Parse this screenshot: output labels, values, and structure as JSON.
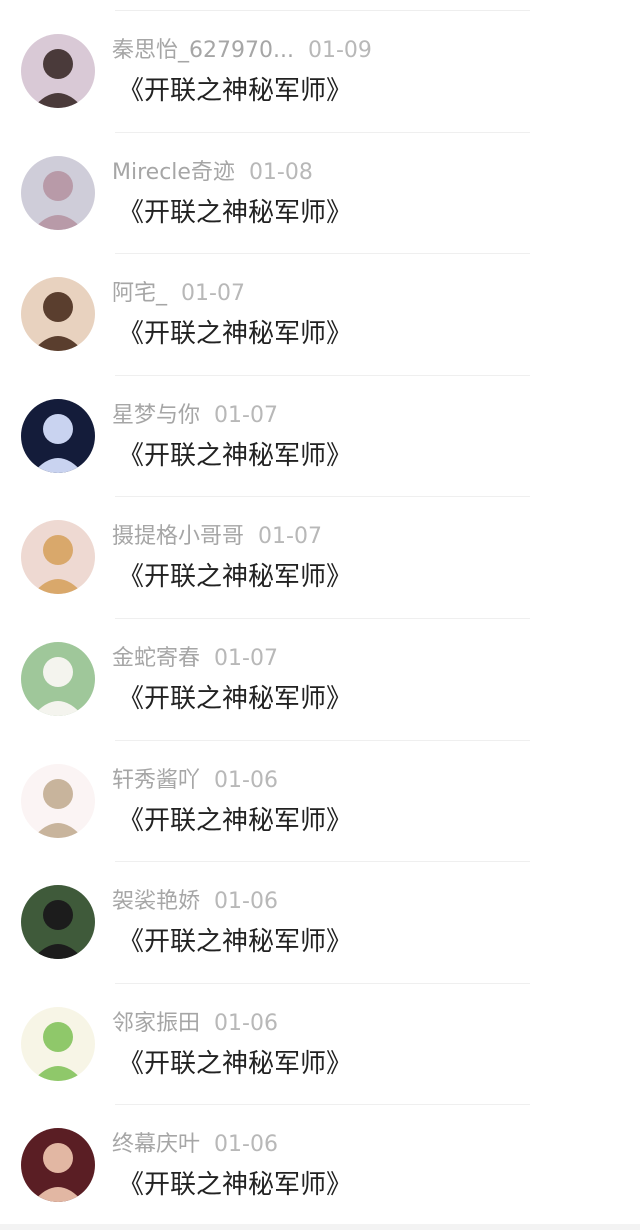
{
  "entries": [
    {
      "username": "秦思怡_627970...",
      "date": "01-09",
      "title": "《开联之神秘军师》",
      "avatar_bg": "#d9c9d6",
      "avatar_fg": "#4a3a3a"
    },
    {
      "username": "Mirecle奇迹",
      "date": "01-08",
      "title": "《开联之神秘军师》",
      "avatar_bg": "#cfcdd9",
      "avatar_fg": "#b89aa8"
    },
    {
      "username": "阿宅_",
      "date": "01-07",
      "title": "《开联之神秘军师》",
      "avatar_bg": "#e8d2bf",
      "avatar_fg": "#5a3e2e"
    },
    {
      "username": "星梦与你",
      "date": "01-07",
      "title": "《开联之神秘军师》",
      "avatar_bg": "#141c3a",
      "avatar_fg": "#c9d3f0"
    },
    {
      "username": "摄提格小哥哥",
      "date": "01-07",
      "title": "《开联之神秘军师》",
      "avatar_bg": "#eed9d2",
      "avatar_fg": "#d9a86b"
    },
    {
      "username": "金蛇寄春",
      "date": "01-07",
      "title": "《开联之神秘军师》",
      "avatar_bg": "#9fc79a",
      "avatar_fg": "#f4f4ee"
    },
    {
      "username": "轩秀酱吖",
      "date": "01-06",
      "title": "《开联之神秘军师》",
      "avatar_bg": "#fbf4f4",
      "avatar_fg": "#c8b49c"
    },
    {
      "username": "袈裟艳娇",
      "date": "01-06",
      "title": "《开联之神秘军师》",
      "avatar_bg": "#3f5a3a",
      "avatar_fg": "#1c1c1c"
    },
    {
      "username": "邻家振田",
      "date": "01-06",
      "title": "《开联之神秘军师》",
      "avatar_bg": "#f7f5e6",
      "avatar_fg": "#8fc86a"
    },
    {
      "username": "终幕庆叶",
      "date": "01-06",
      "title": "《开联之神秘军师》",
      "avatar_bg": "#5a1e24",
      "avatar_fg": "#e2b7a3"
    }
  ]
}
